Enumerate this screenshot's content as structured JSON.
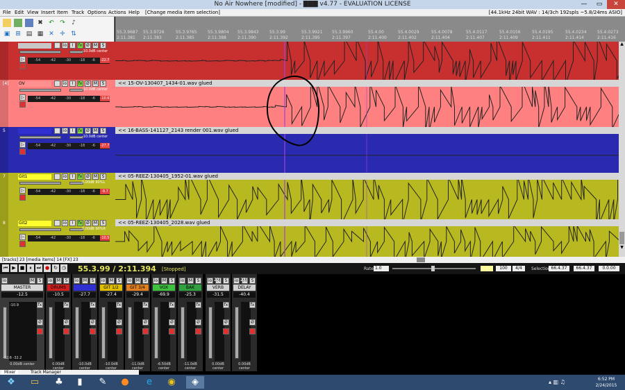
{
  "window": {
    "title": "No Air Nowhere [modified] - ▇▇▇ v4.77 - EVALUATION LICENSE",
    "controls": [
      "—",
      "▭",
      "✕"
    ]
  },
  "menu": {
    "items": [
      "File",
      "Edit",
      "View",
      "Insert",
      "Item",
      "Track",
      "Options",
      "Actions",
      "Help"
    ],
    "status": "[Change media item selection]",
    "audio": "[44.1kHz 24bit WAV : 14/3ch 192spls ~5.8/24ms ASIO]"
  },
  "ruler": {
    "bars": [
      "55.3.9687",
      "55.3.9726",
      "55.3.9765",
      "55.3.9804",
      "55.3.9843",
      "55.3.99",
      "55.3.9921",
      "55.3.9960",
      "55.4.00",
      "55.4.0029",
      "55.4.0078",
      "55.4.0117",
      "55.4.0156",
      "55.4.0195",
      "55.4.0234",
      "55.4.0273"
    ],
    "times": [
      "2:11.381",
      "2:11.383",
      "2:11.385",
      "2:11.388",
      "2:11.390",
      "2:11.392",
      "2:11.395",
      "2:11.397",
      "2:11.400",
      "2:11.402",
      "2:11.404",
      "2:11.407",
      "2:11.409",
      "2:11.411",
      "2:11.414",
      "2:11.416"
    ]
  },
  "tracks": [
    {
      "num": "",
      "name": "",
      "pan": "-10.0dB center",
      "peak": "-22.7",
      "color": "#c8c8c8",
      "wave_label": ""
    },
    {
      "num": "[4]",
      "name": "OV",
      "pan": "-10.0dB center",
      "peak": "-10.6",
      "color": "#ff9090",
      "wave_label": "<< 15-OV-130407_1434-01.wav glued"
    },
    {
      "num": "5",
      "name": "",
      "pan": "-10.0dB center",
      "peak": "-27.7",
      "color": "#3030d0",
      "wave_label": "<< 16-BASS-141127_2143 render 001.wav glued"
    },
    {
      "num": "7",
      "name": "Git1",
      "pan": "0.00dB 90%L",
      "peak": "-9.7",
      "color": "#ffff30",
      "wave_label": "<< 05-REEZ-130405_1952-01.wav glued"
    },
    {
      "num": "8",
      "name": "Git2",
      "pan": "0.00dB 90%R",
      "peak": "-10.5",
      "color": "#ffff30",
      "wave_label": "<< 05-REEZ-130405_2028.wav glued"
    }
  ],
  "meter_scale": [
    "-54",
    "-42",
    "-30",
    "-18",
    "-6"
  ],
  "statusbar": {
    "left": "[tracks] 23 [media items] 14 [FX] 23"
  },
  "transport": {
    "position": "55.3.99 / 2:11.394",
    "state": "[Stopped]",
    "rate_label": "Rate:",
    "rate": "1.0",
    "bpm": "100",
    "sig": "4/4",
    "sel_label": "Selection:",
    "sel_start": "66.4.37",
    "sel_end": "66.4.37",
    "sel_len": "0.0.00"
  },
  "mixer": {
    "strips": [
      {
        "num": "",
        "name": "MASTER",
        "color": "#d8d8d8",
        "db": "-12.5",
        "peak": "-10.9",
        "pan": "0.00dB center",
        "bottom": "-32.6 -32.2"
      },
      {
        "num": "",
        "name": "DRUMS",
        "color": "#d02020",
        "db": "-10.5",
        "peak": "",
        "pan": "0.00dB center"
      },
      {
        "num": "",
        "name": "",
        "color": "#3030d0",
        "db": "-27.7",
        "peak": "",
        "pan": "-10.0dB center"
      },
      {
        "num": "",
        "name": "GIT 1/2",
        "color": "#e0c000",
        "db": "-27.4",
        "peak": "",
        "pan": "-10.0dB center"
      },
      {
        "num": "",
        "name": "GIT 3/4",
        "color": "#e08020",
        "db": "-29.4",
        "peak": "",
        "pan": "-11.0dB center"
      },
      {
        "num": "",
        "name": "VOX",
        "color": "#40c040",
        "db": "-69.9",
        "peak": "",
        "pan": "-6.50dB center"
      },
      {
        "num": "",
        "name": "BAK",
        "color": "#30a040",
        "db": "-25.3",
        "peak": "",
        "pan": "-11.0dB center"
      },
      {
        "num": "22",
        "name": "VERB",
        "color": "#d0d0d0",
        "db": "-31.5",
        "peak": "",
        "pan": "0.00dB center"
      },
      {
        "num": "23",
        "name": "DELAY",
        "color": "#d0d0d0",
        "db": "-40.4",
        "peak": "",
        "pan": "0.00dB center"
      }
    ]
  },
  "mixer_tabs": [
    "Mixer",
    "Track Manager"
  ],
  "taskbar": {
    "time": "6:52 PM",
    "date": "2/24/2015"
  },
  "colors": {
    "lane_red": "#c83030",
    "lane_pink": "#ff8080",
    "lane_blue": "#2a2ab0",
    "lane_olive": "#b8b820",
    "cursor": "#a040e0"
  }
}
